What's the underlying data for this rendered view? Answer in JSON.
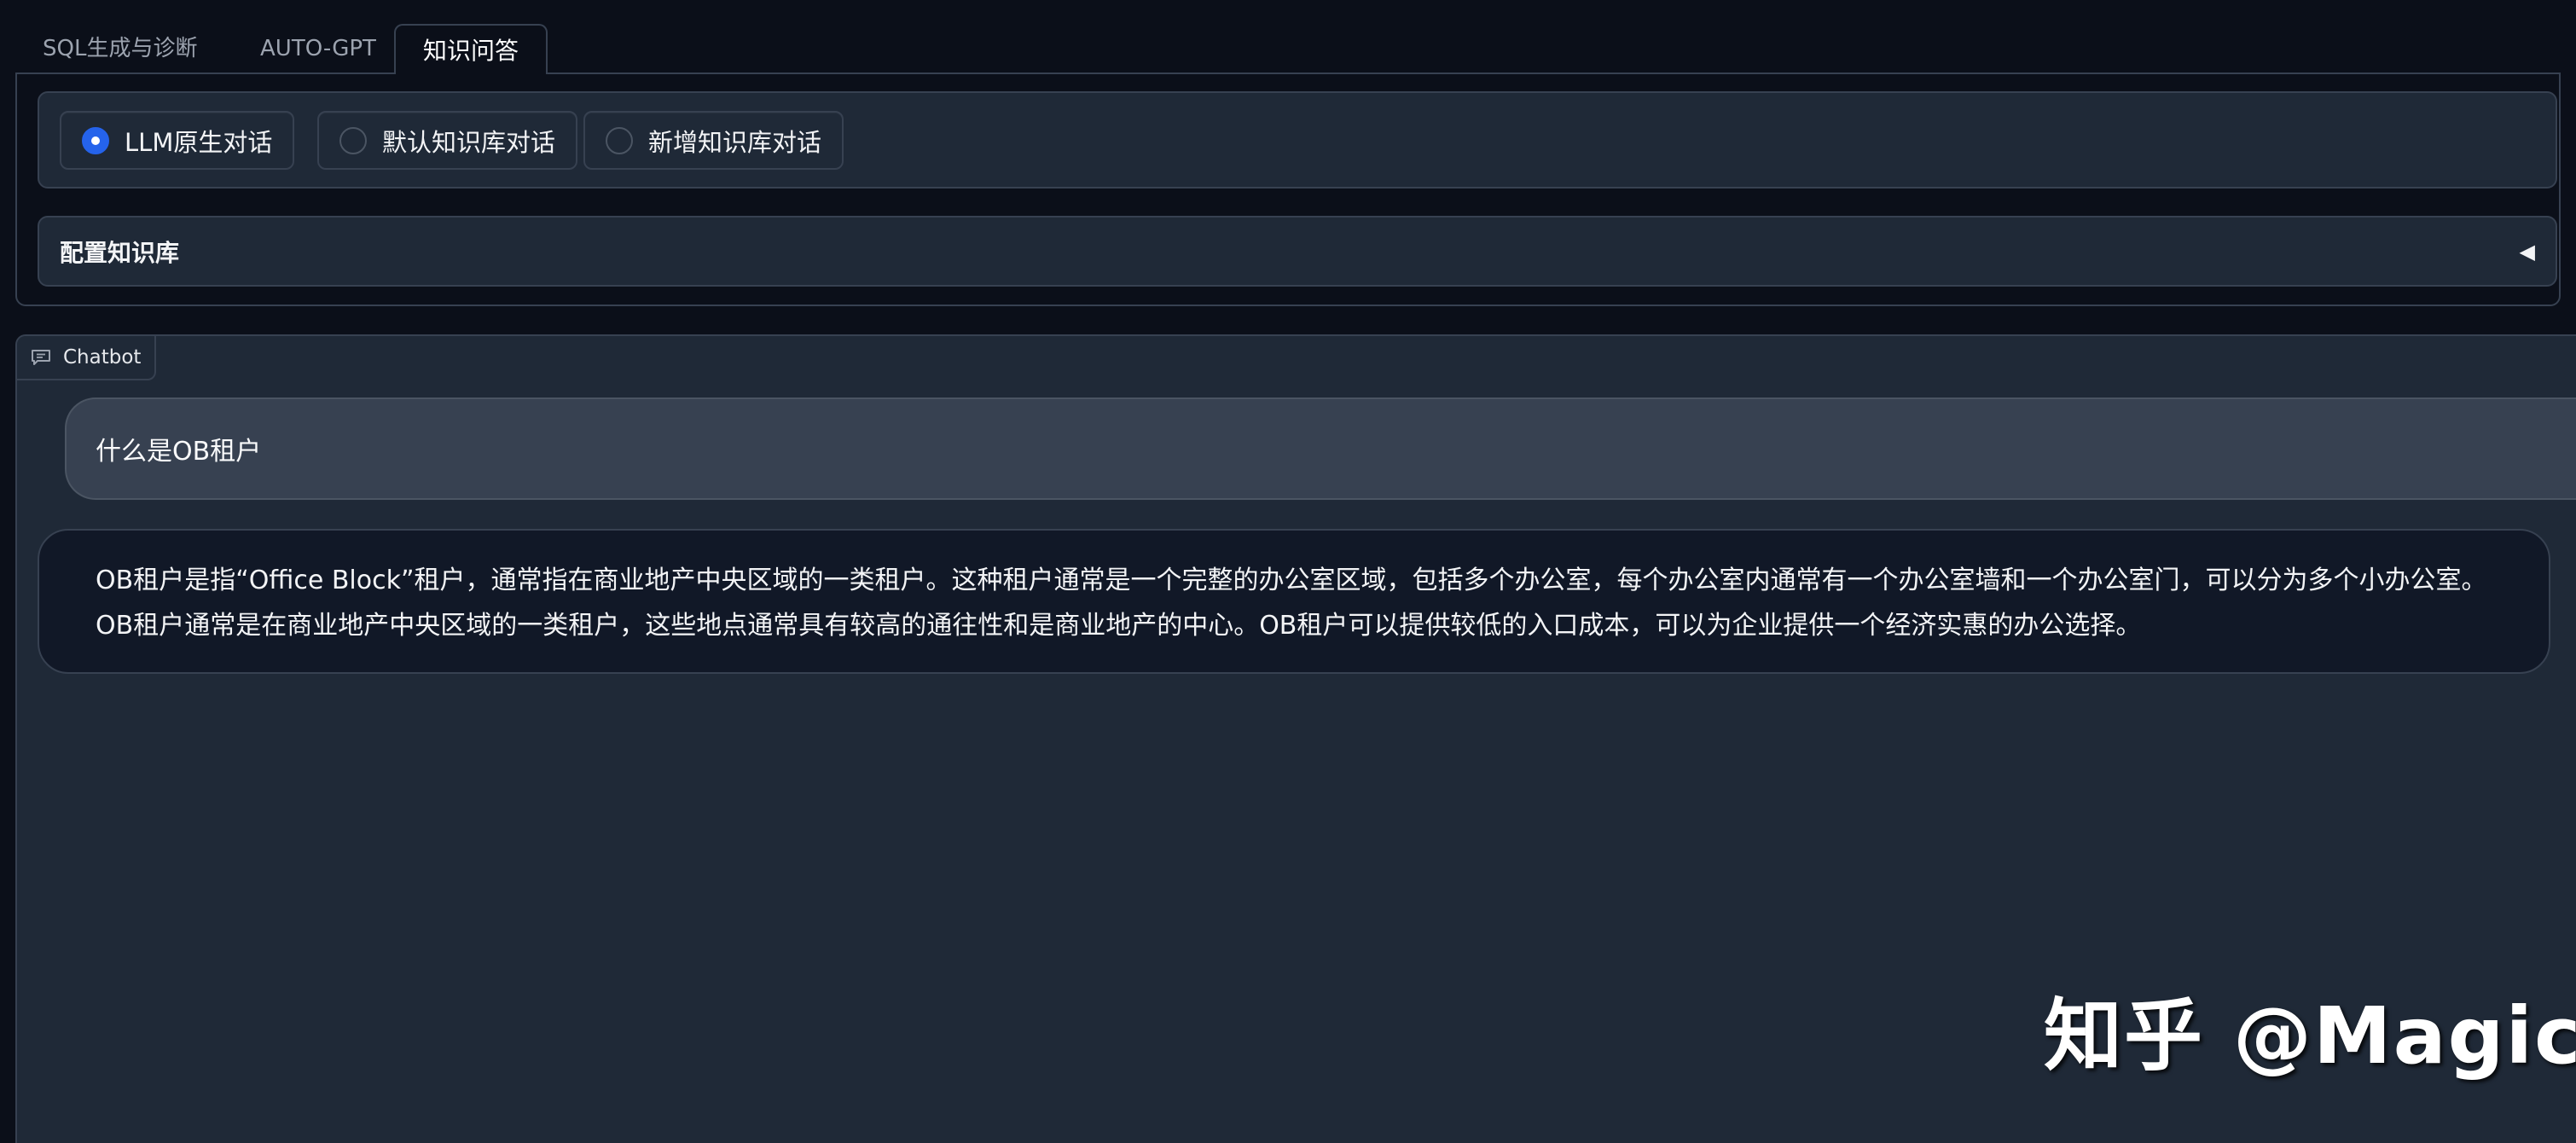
{
  "tabs": [
    {
      "label": "SQL生成与诊断",
      "active": false
    },
    {
      "label": "AUTO-GPT",
      "active": false
    },
    {
      "label": "知识问答",
      "active": true
    }
  ],
  "mode_radio": {
    "options": [
      {
        "label": "LLM原生对话",
        "checked": true
      },
      {
        "label": "默认知识库对话",
        "checked": false
      },
      {
        "label": "新增知识库对话",
        "checked": false
      }
    ]
  },
  "accordion": {
    "title": "配置知识库",
    "icon": "triangle-left-icon",
    "icon_glyph": "◀"
  },
  "chatbot": {
    "label": "Chatbot",
    "icon": "chat-icon",
    "messages": [
      {
        "role": "user",
        "text": "什么是OB租户"
      },
      {
        "role": "bot",
        "text": "OB租户是指“Office Block”租户，通常指在商业地产中央区域的一类租户。这种租户通常是一个完整的办公室区域，包括多个办公室，每个办公室内通常有一个办公室墙和一个办公室门，可以分为多个小办公室。OB租户通常是在商业地产中央区域的一类租户，这些地点通常具有较高的通往性和是商业地产的中心。OB租户可以提供较低的入口成本，可以为企业提供一个经济实惠的办公选择。"
      }
    ]
  },
  "watermark": "知乎 @Magic",
  "colors": {
    "background": "#0b0f19",
    "panel": "#1f2937",
    "border": "#374151",
    "accent": "#2563eb",
    "user_bubble": "#374151",
    "bot_bubble": "#111827"
  }
}
